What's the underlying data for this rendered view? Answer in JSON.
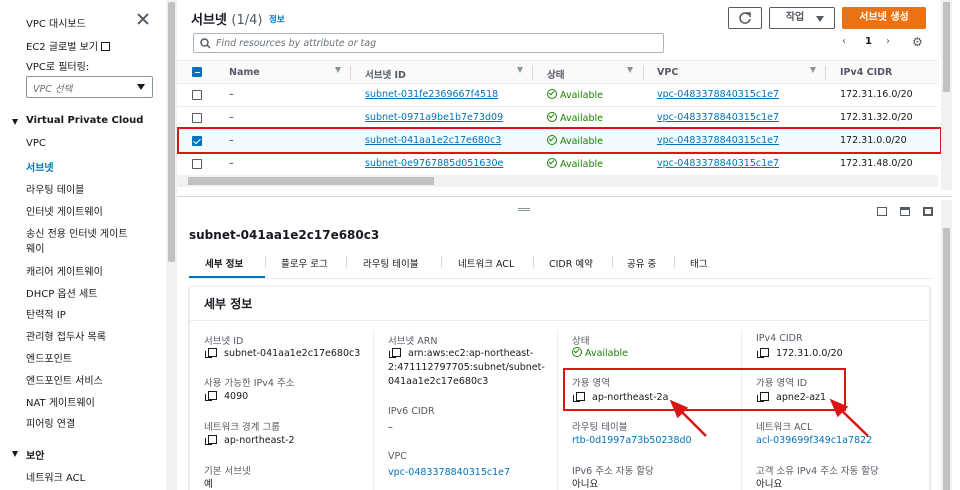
{
  "sidebar": {
    "dashboard": "VPC 대시보드",
    "ec2_global": "EC2 글로벌 보기",
    "filter_label": "VPC로 필터링:",
    "filter_placeholder": "VPC 선택",
    "section_vpc": "Virtual Private Cloud",
    "items": [
      "VPC",
      "서브넷",
      "라우팅 테이블",
      "인터넷 게이트웨이",
      "송신 전용 인터넷 게이트",
      "웨이",
      "캐리어 게이트웨이",
      "DHCP 옵션 세트",
      "탄력적 IP",
      "관리형 접두사 목록",
      "엔드포인트",
      "엔드포인트 서비스",
      "NAT 게이트웨이",
      "피어링 연결"
    ],
    "section_security": "보안",
    "security_items": [
      "네트워크 ACL"
    ]
  },
  "list": {
    "title": "서브넷",
    "count": "(1/4)",
    "info": "정보",
    "actions_label": "작업",
    "create_label": "서브넷 생성",
    "search_placeholder": "Find resources by attribute or tag",
    "page": "1",
    "columns": [
      "Name",
      "서브넷 ID",
      "상태",
      "VPC",
      "IPv4 CIDR"
    ],
    "rows": [
      {
        "name": "–",
        "subnet_id": "subnet-031fe2369667f4518",
        "state": "Available",
        "vpc": "vpc-0483378840315c1e7",
        "cidr": "172.31.16.0/20"
      },
      {
        "name": "–",
        "subnet_id": "subnet-0971a9be1b7e73d09",
        "state": "Available",
        "vpc": "vpc-0483378840315c1e7",
        "cidr": "172.31.32.0/20"
      },
      {
        "name": "–",
        "subnet_id": "subnet-041aa1e2c17e680c3",
        "state": "Available",
        "vpc": "vpc-0483378840315c1e7",
        "cidr": "172.31.0.0/20"
      },
      {
        "name": "–",
        "subnet_id": "subnet-0e9767885d051630e",
        "state": "Available",
        "vpc": "vpc-0483378840315c1e7",
        "cidr": "172.31.48.0/20"
      }
    ]
  },
  "detail": {
    "title": "subnet-041aa1e2c17e680c3",
    "tabs": [
      "세부 정보",
      "플로우 로그",
      "라우팅 테이블",
      "네트워크 ACL",
      "CIDR 예약",
      "공유 중",
      "태그"
    ],
    "card_title": "세부 정보",
    "fields": {
      "subnet_id_label": "서브넷 ID",
      "subnet_id": "subnet-041aa1e2c17e680c3",
      "ipv4_avail_label": "사용 가능한 IPv4 주소",
      "ipv4_avail": "4090",
      "border_group_label": "네트워크 경계 그룹",
      "border_group": "ap-northeast-2",
      "default_subnet_label": "기본 서브넷",
      "default_subnet": "예",
      "arn_label": "서브넷 ARN",
      "arn_1": "arn:aws:ec2:ap-northeast-",
      "arn_2": "2:471112797705:subnet/subnet-",
      "arn_3": "041aa1e2c17e680c3",
      "ipv6_label": "IPv6 CIDR",
      "ipv6": "–",
      "vpc_label": "VPC",
      "vpc": "vpc-0483378840315c1e7",
      "state_label": "상태",
      "state": "Available",
      "az_label": "가용 영역",
      "az": "ap-northeast-2a",
      "rtb_label": "라우팅 테이블",
      "rtb": "rtb-0d1997a73b50238d0",
      "ipv6_auto_label": "IPv6 주소 자동 할당",
      "ipv6_auto": "아니요",
      "cidr_label": "IPv4 CIDR",
      "cidr": "172.31.0.0/20",
      "az_id_label": "가용 영역 ID",
      "az_id": "apne2-az1",
      "acl_label": "네트워크 ACL",
      "acl": "acl-039699f349c1a7822",
      "customer_ipv4_label": "고객 소유 IPv4 주소 자동 할당",
      "customer_ipv4": "아니요"
    }
  },
  "colors": {
    "accent": "#0073bb",
    "primary_button": "#ec7211",
    "available": "#1d8102",
    "highlight": "#d91515"
  }
}
